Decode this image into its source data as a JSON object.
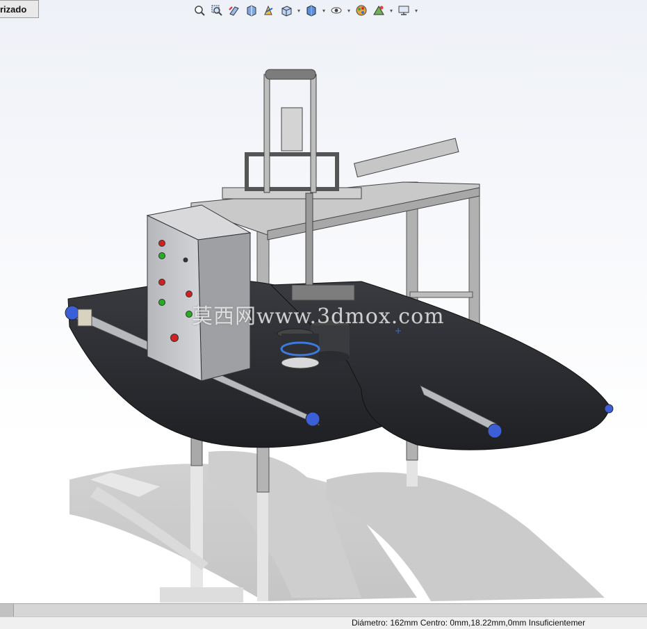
{
  "tab": {
    "label": "rizado"
  },
  "toolbar": {
    "icons": [
      "zoom-to-fit-icon",
      "zoom-to-area-icon",
      "previous-view-icon",
      "section-view-icon",
      "dynamic-annotation-icon",
      "view-orientation-icon",
      "display-style-icon",
      "hide-show-items-icon",
      "edit-appearance-icon",
      "apply-scene-icon",
      "view-settings-icon"
    ]
  },
  "watermark": {
    "text": "莫西网www.3dmox.com"
  },
  "status": {
    "text": "Diámetro: 162mm  Centro: 0mm,18.22mm,0mm   Insuficientemer"
  },
  "colors": {
    "belt": "#2c2d31",
    "frame": "#b9b9b9",
    "cabinet": "#c4c4c6",
    "accent_blue": "#3b5fd6"
  }
}
